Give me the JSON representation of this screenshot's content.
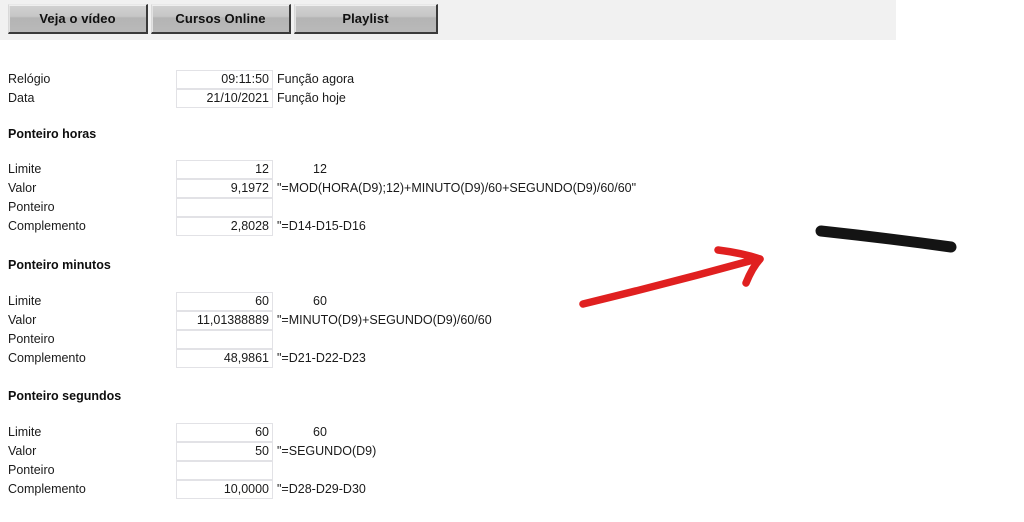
{
  "nav": {
    "buttons": [
      {
        "label": "Veja o vídeo",
        "name": "nav-button-veja-o-video"
      },
      {
        "label": "Cursos Online",
        "name": "nav-button-cursos-online"
      },
      {
        "label": "Playlist",
        "name": "nav-button-playlist"
      }
    ]
  },
  "top_rows": [
    {
      "label": "Relógio",
      "value": "09:11:50",
      "note": "Função agora"
    },
    {
      "label": "Data",
      "value": "21/10/2021",
      "note": "Função hoje"
    }
  ],
  "sections": [
    {
      "title": "Ponteiro horas",
      "rows": [
        {
          "label": "Limite",
          "value": "12",
          "note": "12",
          "note_centered": true
        },
        {
          "label": "Valor",
          "value": "9,1972",
          "note": "\"=MOD(HORA(D9);12)+MINUTO(D9)/60+SEGUNDO(D9)/60/60\"",
          "note_centered": false
        },
        {
          "label": "Ponteiro",
          "value": "",
          "note": "",
          "note_centered": false
        },
        {
          "label": "Complemento",
          "value": "2,8028",
          "note": "\"=D14-D15-D16",
          "note_centered": false
        }
      ]
    },
    {
      "title": "Ponteiro minutos",
      "rows": [
        {
          "label": "Limite",
          "value": "60",
          "note": "60",
          "note_centered": true
        },
        {
          "label": "Valor",
          "value": "11,01388889",
          "note": "\"=MINUTO(D9)+SEGUNDO(D9)/60/60",
          "note_centered": false
        },
        {
          "label": "Ponteiro",
          "value": "",
          "note": "",
          "note_centered": false
        },
        {
          "label": "Complemento",
          "value": "48,9861",
          "note": "\"=D21-D22-D23",
          "note_centered": false
        }
      ]
    },
    {
      "title": "Ponteiro segundos",
      "rows": [
        {
          "label": "Limite",
          "value": "60",
          "note": "60",
          "note_centered": true
        },
        {
          "label": "Valor",
          "value": "50",
          "note": "\"=SEGUNDO(D9)",
          "note_centered": false
        },
        {
          "label": "Ponteiro",
          "value": "",
          "note": "",
          "note_centered": false
        },
        {
          "label": "Complemento",
          "value": "10,0000",
          "note": "\"=D28-D29-D30",
          "note_centered": false
        }
      ]
    }
  ],
  "annotations": {
    "arrow": {
      "color": "#e02020",
      "name": "red-arrow-annotation"
    },
    "line": {
      "color": "#141414",
      "name": "black-line-annotation"
    }
  },
  "colors": {
    "nav_bar_background": "#f1f1f1",
    "button_face": "#c2c2c2",
    "cell_border": "#e2e2e6",
    "text": "#1a1a1a",
    "arrow_red": "#e02020",
    "line_black": "#141414"
  }
}
